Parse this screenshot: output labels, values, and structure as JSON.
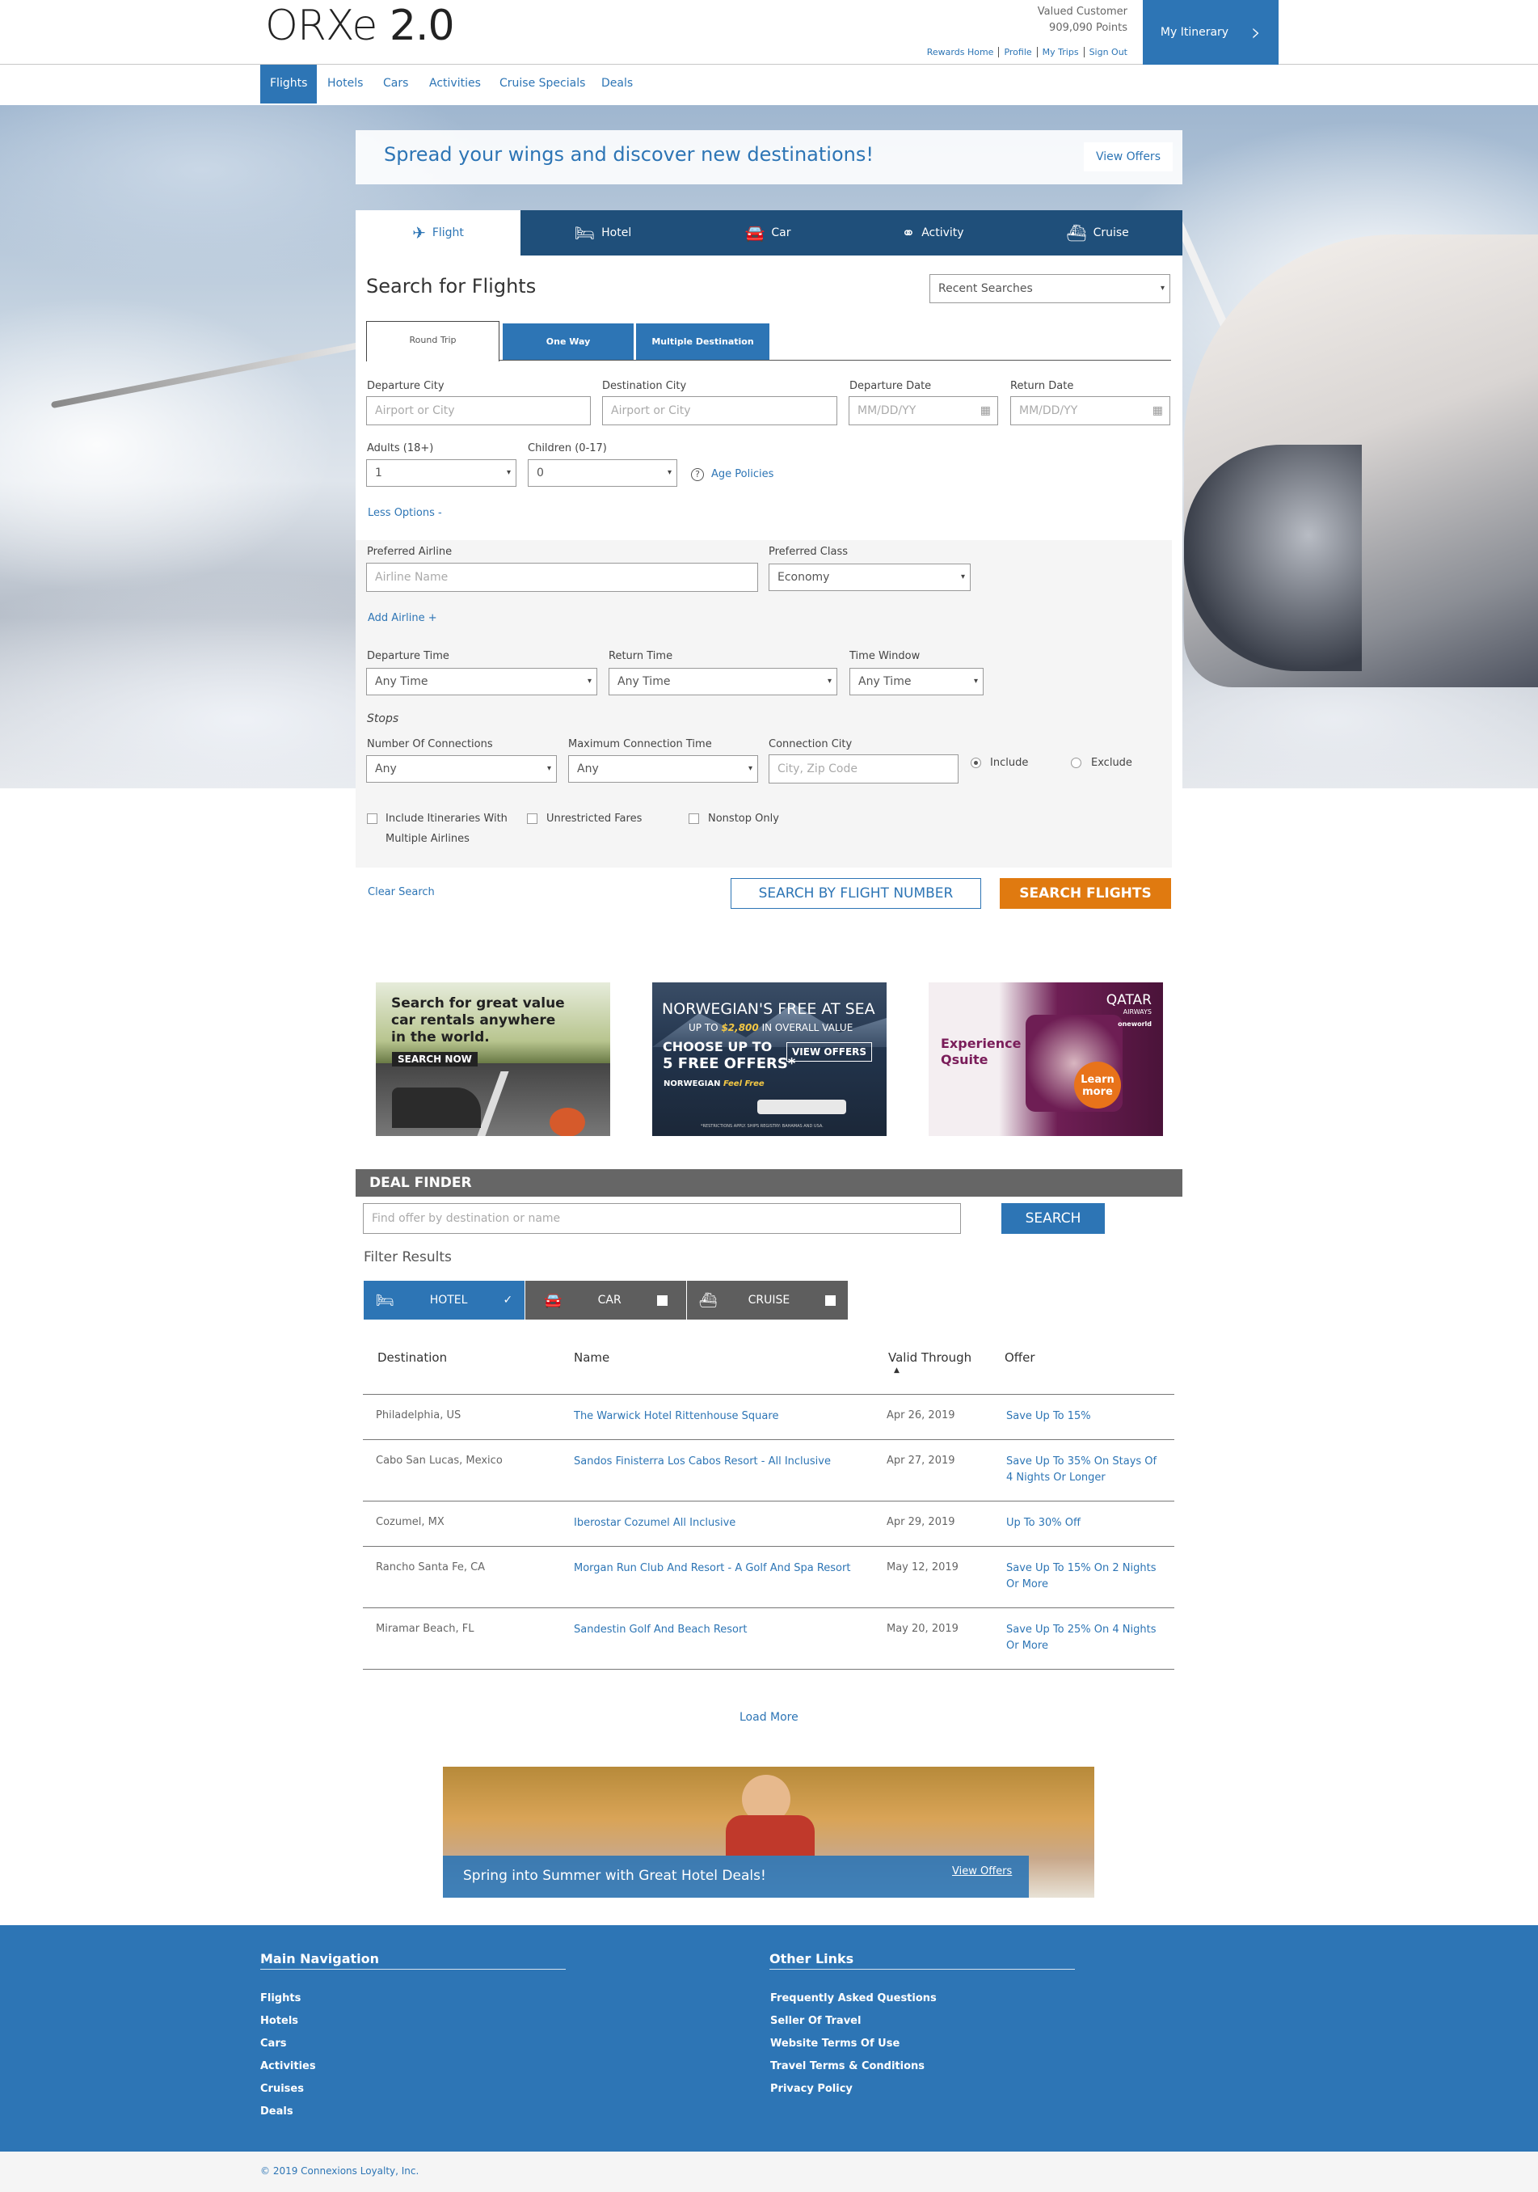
{
  "header": {
    "logo_main": "ORXe",
    "logo_version": "2.0",
    "user_name": "Valued Customer",
    "points": "909,090 Points",
    "links": [
      "Rewards Home",
      "Profile",
      "My Trips",
      "Sign Out"
    ],
    "itinerary_label": "My Itinerary"
  },
  "nav": [
    "Flights",
    "Hotels",
    "Cars",
    "Activities",
    "Cruise Specials",
    "Deals"
  ],
  "promo": {
    "text": "Spread your wings and discover new destinations!",
    "button": "View Offers"
  },
  "search_tabs": [
    "Flight",
    "Hotel",
    "Car",
    "Activity",
    "Cruise"
  ],
  "search": {
    "title": "Search for Flights",
    "recent": "Recent Searches",
    "trip_types": [
      "Round Trip",
      "One Way",
      "Multiple Destination"
    ],
    "departure_city_label": "Departure City",
    "departure_city_ph": "Airport or City",
    "destination_city_label": "Destination City",
    "destination_city_ph": "Airport or City",
    "departure_date_label": "Departure Date",
    "departure_date_ph": "MM/DD/YY",
    "return_date_label": "Return Date",
    "return_date_ph": "MM/DD/YY",
    "adults_label": "Adults (18+)",
    "adults_value": "1",
    "children_label": "Children (0-17)",
    "children_value": "0",
    "age_policies": "Age Policies",
    "less_options": "Less Options -",
    "pref_airline_label": "Preferred Airline",
    "pref_airline_ph": "Airline Name",
    "pref_class_label": "Preferred Class",
    "pref_class_value": "Economy",
    "add_airline": "Add Airline +",
    "dep_time_label": "Departure Time",
    "dep_time_value": "Any Time",
    "ret_time_label": "Return Time",
    "ret_time_value": "Any Time",
    "window_label": "Time Window",
    "window_value": "Any Time",
    "stops": "Stops",
    "connections_label": "Number Of Connections",
    "connections_value": "Any",
    "max_conn_label": "Maximum Connection Time",
    "max_conn_value": "Any",
    "conn_city_label": "Connection City",
    "conn_city_ph": "City, Zip Code",
    "include": "Include",
    "exclude": "Exclude",
    "multi_airlines_1": "Include Itineraries With",
    "multi_airlines_2": "Multiple Airlines",
    "unrestricted": "Unrestricted Fares",
    "nonstop": "Nonstop Only",
    "clear": "Clear Search",
    "by_flight_number": "SEARCH BY FLIGHT NUMBER",
    "search_button": "SEARCH FLIGHTS"
  },
  "ads": {
    "car": {
      "l1": "Search for great value",
      "l2": "car rentals anywhere",
      "l3": "in the world.",
      "cta": "SEARCH NOW"
    },
    "cruise": {
      "l1": "NORWEGIAN'S FREE AT SEA",
      "l2a": "UP TO ",
      "l2b": "$2,800",
      "l2c": " IN OVERALL VALUE",
      "l3": "CHOOSE UP TO",
      "l4": "5 FREE OFFERS*",
      "cta": "VIEW OFFERS",
      "brand": "NORWEGIAN",
      "tagline": "Feel Free",
      "fine": "*RESTRICTIONS APPLY. SHIPS REGISTRY: BAHAMAS AND USA."
    },
    "qatar": {
      "brand": "QATAR",
      "sub": "AIRWAYS",
      "alliance": "oneworld",
      "l1": "Experience",
      "l2": "Qsuite",
      "cta1": "Learn",
      "cta2": "more"
    }
  },
  "deal_finder": {
    "title": "DEAL FINDER",
    "placeholder": "Find offer by destination or name",
    "search": "SEARCH",
    "filter_label": "Filter Results",
    "filters": [
      "HOTEL",
      "CAR",
      "CRUISE"
    ],
    "columns": [
      "Destination",
      "Name",
      "Valid Through",
      "Offer"
    ],
    "rows": [
      {
        "dest": "Philadelphia, US",
        "name": "The Warwick Hotel Rittenhouse Square",
        "valid": "Apr 26, 2019",
        "offer1": "Save Up To 15%",
        "offer2": ""
      },
      {
        "dest": "Cabo San Lucas, Mexico",
        "name": "Sandos Finisterra Los Cabos Resort - All Inclusive",
        "valid": "Apr 27, 2019",
        "offer1": "Save Up To 35% On Stays Of",
        "offer2": "4 Nights Or Longer"
      },
      {
        "dest": "Cozumel, MX",
        "name": "Iberostar Cozumel All Inclusive",
        "valid": "Apr 29, 2019",
        "offer1": "Up To 30% Off",
        "offer2": ""
      },
      {
        "dest": "Rancho Santa Fe, CA",
        "name": "Morgan Run Club And Resort - A Golf And Spa Resort",
        "valid": "May 12, 2019",
        "offer1": "Save Up To 15% On 2 Nights",
        "offer2": "Or More"
      },
      {
        "dest": "Miramar Beach, FL",
        "name": "Sandestin Golf And Beach Resort",
        "valid": "May 20, 2019",
        "offer1": "Save Up To 25% On 4 Nights",
        "offer2": "Or More"
      }
    ],
    "load_more": "Load More"
  },
  "bottom_promo": {
    "text": "Spring into Summer with Great Hotel Deals!",
    "link": "View Offers"
  },
  "footer": {
    "main_nav_title": "Main Navigation",
    "main_nav": [
      "Flights",
      "Hotels",
      "Cars",
      "Activities",
      "Cruises",
      "Deals"
    ],
    "other_title": "Other Links",
    "other": [
      "Frequently Asked Questions",
      "Seller Of Travel",
      "Website Terms Of Use",
      "Travel Terms & Conditions",
      "Privacy Policy"
    ],
    "copyright": "© 2019 Connexions Loyalty, Inc."
  },
  "colors": {
    "brand_blue": "#2d75b5",
    "orange": "#e07a10",
    "dark_blue": "#1f4f7a"
  }
}
